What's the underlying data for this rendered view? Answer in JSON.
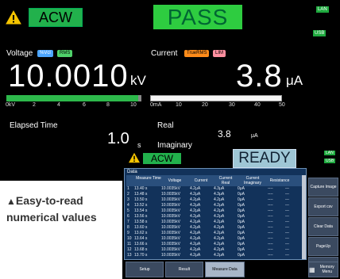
{
  "main": {
    "mode": "ACW",
    "result": "PASS",
    "top_tag_1": "LAN",
    "top_tag_2": "USB",
    "voltage_label": "Voltage",
    "voltage_mode_pill": "%Vcl",
    "voltage_rms_pill": "RMS",
    "current_label": "Current",
    "current_mode_pill": "TrueRMS",
    "current_lim_pill": "LIM",
    "voltage_value": "10.0010",
    "voltage_unit": "kV",
    "current_value": "3.8",
    "current_unit": "μA",
    "voltage_scale": [
      "0kV",
      "2",
      "4",
      "6",
      "8",
      "10"
    ],
    "current_scale": [
      "0mA",
      "10",
      "20",
      "30",
      "40",
      "50"
    ],
    "elapsed_label": "Elapsed Time",
    "elapsed_value": "1.0",
    "elapsed_unit": "s",
    "real_label": "Real",
    "real_value": "3.8",
    "real_unit": "μA",
    "imag_label": "Imaginary",
    "voltage_bar_level": 1.0
  },
  "sub": {
    "mode": "ACW",
    "status": "READY",
    "tag_1": "LAN",
    "tag_2": "USB",
    "table_title": "Data",
    "columns": [
      "",
      "Measure Time",
      "Voltage",
      "Current",
      "Current Real",
      "Current Imaginary",
      "Resistance",
      ""
    ],
    "rows": [
      [
        "1",
        "13.40 s",
        "10.0035kV",
        "4.2μA",
        "4.3μA",
        "0μA",
        "----",
        "---"
      ],
      [
        "2",
        "13.48 s",
        "10.0035kV",
        "4.2μA",
        "4.3μA",
        "0μA",
        "----",
        "---"
      ],
      [
        "3",
        "13.50 s",
        "10.0035kV",
        "4.2μA",
        "4.2μA",
        "0μA",
        "----",
        "---"
      ],
      [
        "4",
        "13.52 s",
        "10.0035kV",
        "4.2μA",
        "4.2μA",
        "0μA",
        "----",
        "---"
      ],
      [
        "5",
        "13.54 s",
        "10.0035kV",
        "4.2μA",
        "4.2μA",
        "0μA",
        "----",
        "---"
      ],
      [
        "6",
        "13.56 s",
        "10.0035kV",
        "4.2μA",
        "4.2μA",
        "0μA",
        "----",
        "---"
      ],
      [
        "7",
        "13.58 s",
        "10.0035kV",
        "4.2μA",
        "4.2μA",
        "0μA",
        "----",
        "---"
      ],
      [
        "8",
        "13.60 s",
        "10.0035kV",
        "4.2μA",
        "4.2μA",
        "0μA",
        "----",
        "---"
      ],
      [
        "9",
        "13.62 s",
        "10.0035kV",
        "4.2μA",
        "4.2μA",
        "0μA",
        "----",
        "---"
      ],
      [
        "10",
        "13.64 s",
        "10.0035kV",
        "4.2μA",
        "4.2μA",
        "0μA",
        "----",
        "---"
      ],
      [
        "11",
        "13.66 s",
        "10.0035kV",
        "4.2μA",
        "4.2μA",
        "0μA",
        "----",
        "---"
      ],
      [
        "12",
        "13.68 s",
        "10.0035kV",
        "4.2μA",
        "4.2μA",
        "0μA",
        "----",
        "---"
      ],
      [
        "13",
        "13.70 s",
        "10.0035kV",
        "4.2μA",
        "4.2μA",
        "0μA",
        "----",
        "---"
      ]
    ],
    "side_buttons": [
      "Capture Image",
      "Export csv",
      "Clear Data",
      "PageUp",
      "PageDown",
      "Memory Menu"
    ],
    "bottom_buttons": [
      "Setup",
      "Result",
      "Measure Data"
    ],
    "colors": {
      "pass": "#2ecc40",
      "ready": "#9fc7d6",
      "mode": "#22b14c"
    }
  },
  "caption": {
    "line1": "Easy-to-read",
    "line2": "numerical values"
  }
}
